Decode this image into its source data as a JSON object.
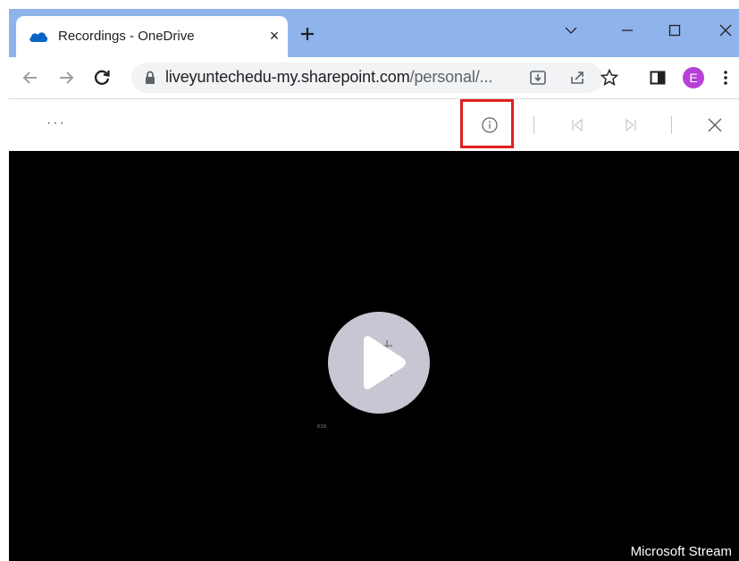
{
  "browser": {
    "tab": {
      "title": "Recordings - OneDrive",
      "close_glyph": "×",
      "icon": "onedrive-cloud-icon"
    },
    "new_tab_icon": "plus-icon",
    "window_controls": [
      "chevron-down-icon",
      "minimize-icon",
      "maximize-icon",
      "close-icon"
    ],
    "address": {
      "url_host": "liveyuntechedu-my.sharepoint.com",
      "url_rest": "/personal/...",
      "lock_icon": "lock-icon"
    },
    "profile_initial": "E",
    "colors": {
      "tabstrip": "#8fb4eb",
      "profile": "#b640d8"
    }
  },
  "viewer": {
    "more_label": "···",
    "icons": [
      "info-icon",
      "previous-icon",
      "next-icon",
      "close-icon"
    ],
    "highlight_color": "#e02020"
  },
  "video": {
    "timestamp": "0:19",
    "brand": "Microsoft Stream"
  }
}
